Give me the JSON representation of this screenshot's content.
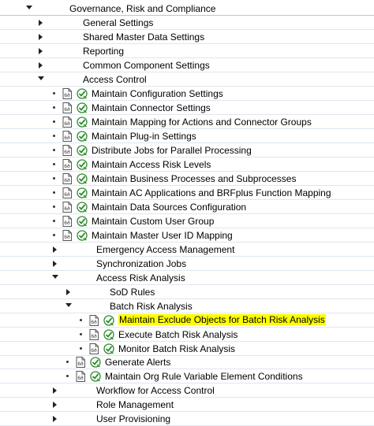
{
  "tree": {
    "root": {
      "label": "Governance, Risk and Compliance"
    },
    "general_settings": "General Settings",
    "shared_master": "Shared Master Data Settings",
    "reporting": "Reporting",
    "common_component": "Common Component Settings",
    "access_control": "Access Control",
    "ac_items": [
      "Maintain Configuration Settings",
      "Maintain Connector Settings",
      "Maintain Mapping for Actions and Connector Groups",
      "Maintain Plug-in Settings",
      "Distribute Jobs for Parallel Processing",
      "Maintain Access Risk Levels",
      "Maintain Business Processes and Subprocesses",
      "Maintain AC Applications and BRFplus Function Mapping",
      "Maintain Data Sources Configuration",
      "Maintain Custom User Group",
      "Maintain Master User ID Mapping"
    ],
    "emergency_access": "Emergency Access Management",
    "synchronization_jobs": "Synchronization Jobs",
    "access_risk_analysis": "Access Risk Analysis",
    "sod_rules": "SoD Rules",
    "batch_risk_analysis": "Batch Risk Analysis",
    "batch_items": [
      "Maintain Exclude Objects for Batch Risk Analysis",
      "Execute Batch Risk Analysis",
      "Monitor Batch Risk Analysis"
    ],
    "generate_alerts": "Generate Alerts",
    "maintain_org_rule": "Maintain Org Rule Variable Element Conditions",
    "workflow": "Workflow for Access Control",
    "role_management": "Role Management",
    "user_provisioning": "User Provisioning"
  },
  "colors": {
    "highlight": "#ffff00",
    "row_border": "#dfe6ef",
    "check_green": "#2e8b2e"
  }
}
